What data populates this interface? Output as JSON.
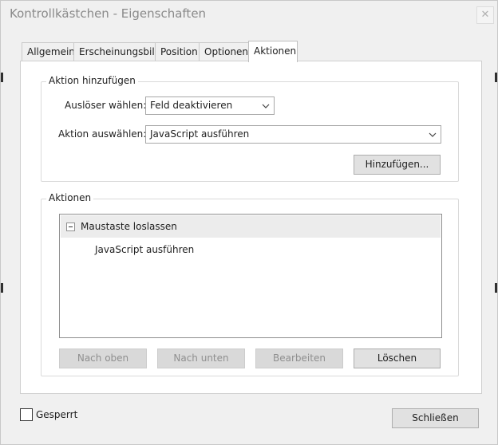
{
  "window": {
    "title": "Kontrollkästchen - Eigenschaften",
    "close_glyph": "✕"
  },
  "tabs": [
    {
      "label": "Allgemein"
    },
    {
      "label": "Erscheinungsbild"
    },
    {
      "label": "Position"
    },
    {
      "label": "Optionen"
    },
    {
      "label": "Aktionen"
    }
  ],
  "add_action": {
    "group_label": "Aktion hinzufügen",
    "trigger_label": "Auslöser wählen:",
    "trigger_value": "Feld deaktivieren",
    "action_label": "Aktion auswählen:",
    "action_value": "JavaScript ausführen",
    "add_button": "Hinzufügen..."
  },
  "actions": {
    "group_label": "Aktionen",
    "tree": {
      "trigger": "Maustaste loslassen",
      "action": "JavaScript ausführen"
    },
    "buttons": {
      "up": "Nach oben",
      "down": "Nach unten",
      "edit": "Bearbeiten",
      "delete": "Löschen"
    }
  },
  "footer": {
    "locked_label": "Gesperrt",
    "close_button": "Schließen"
  }
}
